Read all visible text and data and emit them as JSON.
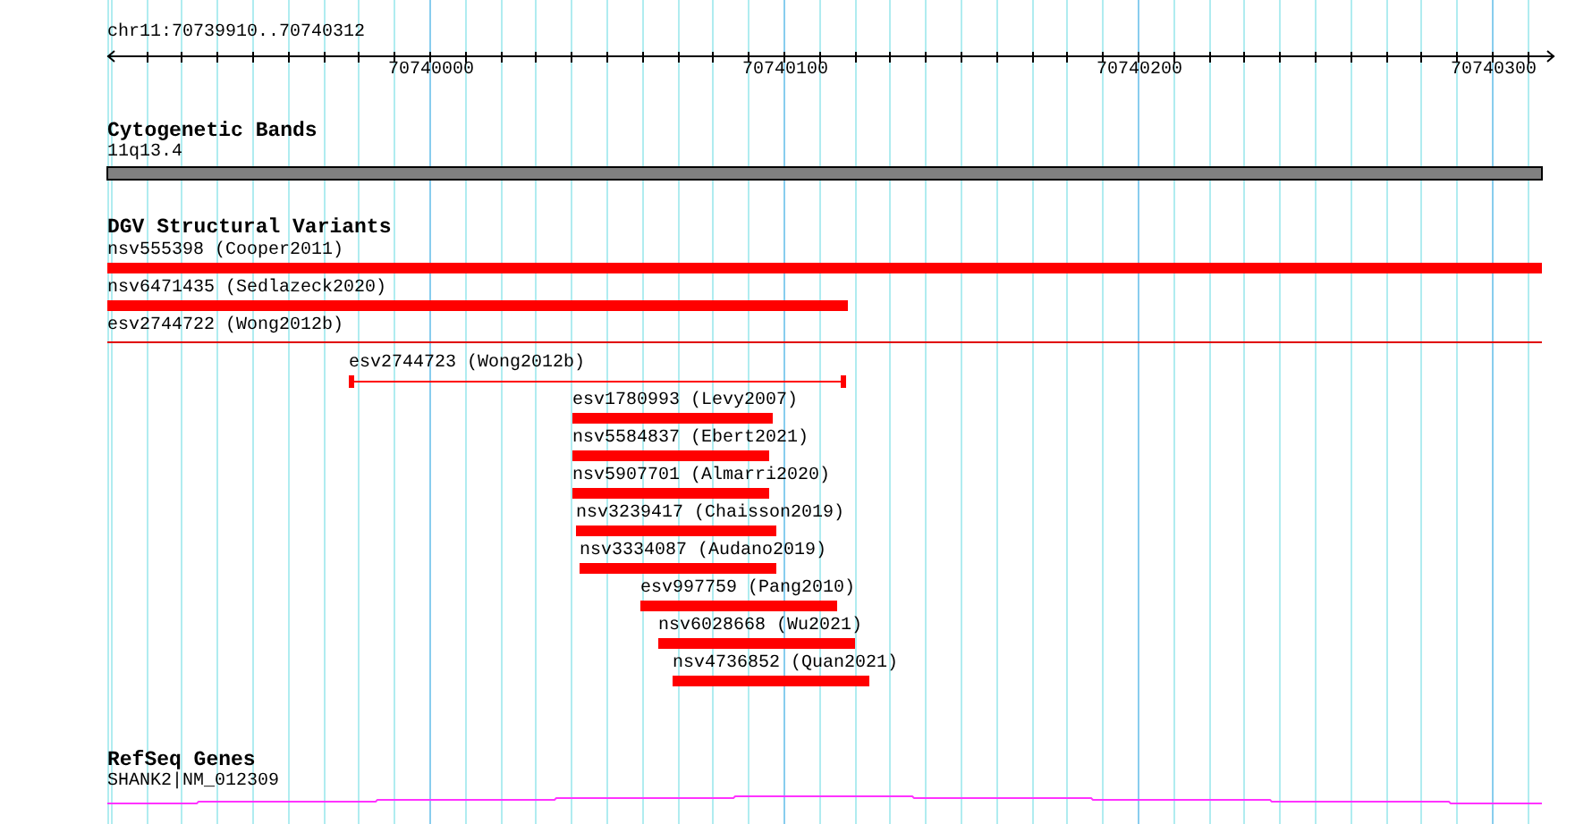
{
  "ruler": {
    "location": "chr11:70739910..70740312",
    "ticks": [
      "70740000",
      "70740100",
      "70740200",
      "70740300"
    ]
  },
  "tracks": [
    {
      "kind": "cytoband",
      "title": "Cytogenetic Bands",
      "features": [
        {
          "label": "11q13.4"
        }
      ]
    },
    {
      "kind": "variants",
      "title": "DGV Structural Variants",
      "features": [
        {
          "label": "nsv555398 (Cooper2011)",
          "kind": "bar"
        },
        {
          "label": "nsv6471435 (Sedlazeck2020)",
          "kind": "bar"
        },
        {
          "label": "esv2744722 (Wong2012b)",
          "kind": "line"
        },
        {
          "label": "esv2744723 (Wong2012b)",
          "kind": "span"
        },
        {
          "label": "esv1780993 (Levy2007)",
          "kind": "bar"
        },
        {
          "label": "nsv5584837 (Ebert2021)",
          "kind": "bar"
        },
        {
          "label": "nsv5907701 (Almarri2020)",
          "kind": "bar"
        },
        {
          "label": "nsv3239417 (Chaisson2019)",
          "kind": "bar"
        },
        {
          "label": "nsv3334087 (Audano2019)",
          "kind": "bar"
        },
        {
          "label": "esv997759 (Pang2010)",
          "kind": "bar"
        },
        {
          "label": "nsv6028668 (Wu2021)",
          "kind": "bar"
        },
        {
          "label": "nsv4736852 (Quan2021)",
          "kind": "bar"
        }
      ]
    },
    {
      "kind": "gene",
      "title": "RefSeq Genes",
      "features": [
        {
          "label": "SHANK2|NM_012309"
        }
      ]
    }
  ]
}
